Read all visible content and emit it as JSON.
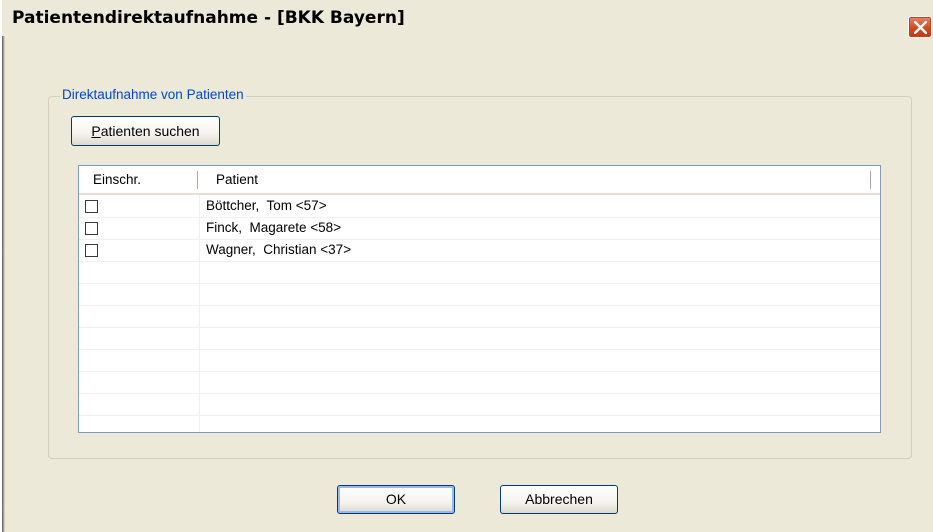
{
  "window": {
    "title": "Patientendirektaufnahme - [BKK Bayern]"
  },
  "group": {
    "label": "Direktaufnahme von Patienten"
  },
  "search_button": {
    "label_underlined": "P",
    "label_rest": "atienten suchen"
  },
  "table": {
    "headers": [
      "Einschr.",
      "Patient"
    ],
    "rows": [
      {
        "restricted": false,
        "patient": "Böttcher,  Tom <57>"
      },
      {
        "restricted": false,
        "patient": "Finck,  Magarete <58>"
      },
      {
        "restricted": false,
        "patient": "Wagner,  Christian <37>"
      }
    ]
  },
  "buttons": {
    "ok": "OK",
    "cancel": "Abbrechen"
  },
  "colors": {
    "group_label": "#0046d5",
    "close_button": "#d24a22",
    "window_bg": "#ece9d8"
  }
}
